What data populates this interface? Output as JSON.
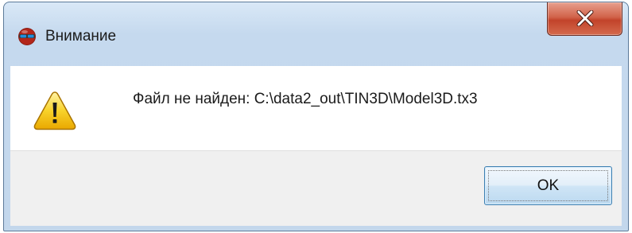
{
  "window": {
    "title": "Внимание",
    "app_icon": "app-glasses-icon"
  },
  "titlebar": {
    "close_icon": "close-icon",
    "close_glyph": "x"
  },
  "content": {
    "icon": "warning-icon",
    "message": "Файл не найден: C:\\data2_out\\TIN3D\\Model3D.tx3"
  },
  "footer": {
    "ok_label": "OK"
  },
  "colors": {
    "titlebar": "#c5d9ee",
    "close_button": "#c2432a",
    "warning_yellow": "#f5c400",
    "footer": "#f0f0f0",
    "button_border": "#3c7fb1"
  }
}
